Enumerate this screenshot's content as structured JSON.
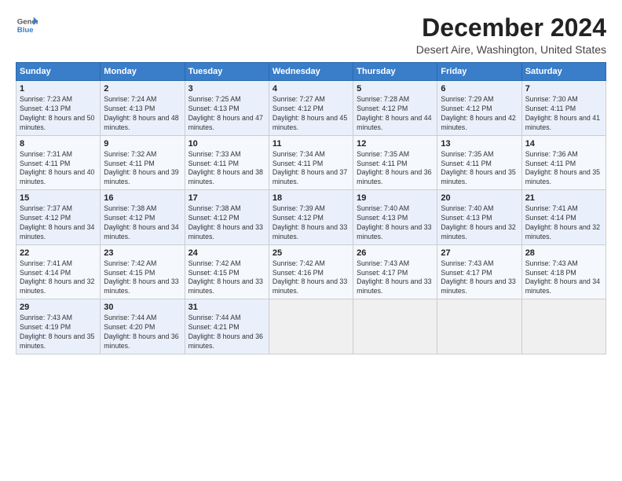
{
  "header": {
    "logo": {
      "line1": "General",
      "line2": "Blue"
    },
    "title": "December 2024",
    "location": "Desert Aire, Washington, United States"
  },
  "days_of_week": [
    "Sunday",
    "Monday",
    "Tuesday",
    "Wednesday",
    "Thursday",
    "Friday",
    "Saturday"
  ],
  "weeks": [
    [
      {
        "day": "1",
        "sunrise": "7:23 AM",
        "sunset": "4:13 PM",
        "daylight": "8 hours and 50 minutes."
      },
      {
        "day": "2",
        "sunrise": "7:24 AM",
        "sunset": "4:13 PM",
        "daylight": "8 hours and 48 minutes."
      },
      {
        "day": "3",
        "sunrise": "7:25 AM",
        "sunset": "4:13 PM",
        "daylight": "8 hours and 47 minutes."
      },
      {
        "day": "4",
        "sunrise": "7:27 AM",
        "sunset": "4:12 PM",
        "daylight": "8 hours and 45 minutes."
      },
      {
        "day": "5",
        "sunrise": "7:28 AM",
        "sunset": "4:12 PM",
        "daylight": "8 hours and 44 minutes."
      },
      {
        "day": "6",
        "sunrise": "7:29 AM",
        "sunset": "4:12 PM",
        "daylight": "8 hours and 42 minutes."
      },
      {
        "day": "7",
        "sunrise": "7:30 AM",
        "sunset": "4:11 PM",
        "daylight": "8 hours and 41 minutes."
      }
    ],
    [
      {
        "day": "8",
        "sunrise": "7:31 AM",
        "sunset": "4:11 PM",
        "daylight": "8 hours and 40 minutes."
      },
      {
        "day": "9",
        "sunrise": "7:32 AM",
        "sunset": "4:11 PM",
        "daylight": "8 hours and 39 minutes."
      },
      {
        "day": "10",
        "sunrise": "7:33 AM",
        "sunset": "4:11 PM",
        "daylight": "8 hours and 38 minutes."
      },
      {
        "day": "11",
        "sunrise": "7:34 AM",
        "sunset": "4:11 PM",
        "daylight": "8 hours and 37 minutes."
      },
      {
        "day": "12",
        "sunrise": "7:35 AM",
        "sunset": "4:11 PM",
        "daylight": "8 hours and 36 minutes."
      },
      {
        "day": "13",
        "sunrise": "7:35 AM",
        "sunset": "4:11 PM",
        "daylight": "8 hours and 35 minutes."
      },
      {
        "day": "14",
        "sunrise": "7:36 AM",
        "sunset": "4:11 PM",
        "daylight": "8 hours and 35 minutes."
      }
    ],
    [
      {
        "day": "15",
        "sunrise": "7:37 AM",
        "sunset": "4:12 PM",
        "daylight": "8 hours and 34 minutes."
      },
      {
        "day": "16",
        "sunrise": "7:38 AM",
        "sunset": "4:12 PM",
        "daylight": "8 hours and 34 minutes."
      },
      {
        "day": "17",
        "sunrise": "7:38 AM",
        "sunset": "4:12 PM",
        "daylight": "8 hours and 33 minutes."
      },
      {
        "day": "18",
        "sunrise": "7:39 AM",
        "sunset": "4:12 PM",
        "daylight": "8 hours and 33 minutes."
      },
      {
        "day": "19",
        "sunrise": "7:40 AM",
        "sunset": "4:13 PM",
        "daylight": "8 hours and 33 minutes."
      },
      {
        "day": "20",
        "sunrise": "7:40 AM",
        "sunset": "4:13 PM",
        "daylight": "8 hours and 32 minutes."
      },
      {
        "day": "21",
        "sunrise": "7:41 AM",
        "sunset": "4:14 PM",
        "daylight": "8 hours and 32 minutes."
      }
    ],
    [
      {
        "day": "22",
        "sunrise": "7:41 AM",
        "sunset": "4:14 PM",
        "daylight": "8 hours and 32 minutes."
      },
      {
        "day": "23",
        "sunrise": "7:42 AM",
        "sunset": "4:15 PM",
        "daylight": "8 hours and 33 minutes."
      },
      {
        "day": "24",
        "sunrise": "7:42 AM",
        "sunset": "4:15 PM",
        "daylight": "8 hours and 33 minutes."
      },
      {
        "day": "25",
        "sunrise": "7:42 AM",
        "sunset": "4:16 PM",
        "daylight": "8 hours and 33 minutes."
      },
      {
        "day": "26",
        "sunrise": "7:43 AM",
        "sunset": "4:17 PM",
        "daylight": "8 hours and 33 minutes."
      },
      {
        "day": "27",
        "sunrise": "7:43 AM",
        "sunset": "4:17 PM",
        "daylight": "8 hours and 33 minutes."
      },
      {
        "day": "28",
        "sunrise": "7:43 AM",
        "sunset": "4:18 PM",
        "daylight": "8 hours and 34 minutes."
      }
    ],
    [
      {
        "day": "29",
        "sunrise": "7:43 AM",
        "sunset": "4:19 PM",
        "daylight": "8 hours and 35 minutes."
      },
      {
        "day": "30",
        "sunrise": "7:44 AM",
        "sunset": "4:20 PM",
        "daylight": "8 hours and 36 minutes."
      },
      {
        "day": "31",
        "sunrise": "7:44 AM",
        "sunset": "4:21 PM",
        "daylight": "8 hours and 36 minutes."
      },
      null,
      null,
      null,
      null
    ]
  ]
}
